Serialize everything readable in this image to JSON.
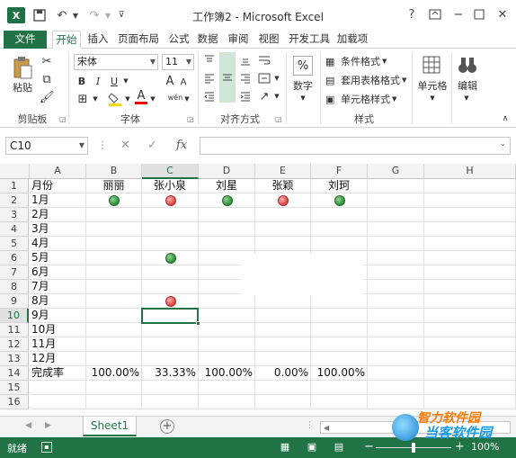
{
  "title_bar": {
    "logo": "X",
    "window_title": "工作簿2 - Microsoft Excel",
    "help": "?",
    "icons": [
      "excel-logo-icon",
      "save-icon",
      "undo-icon",
      "redo-icon",
      "help-icon",
      "ribbon-display-icon",
      "minimize-icon",
      "restore-icon",
      "close-icon"
    ]
  },
  "tabs": {
    "file": "文件",
    "home": "开始",
    "insert": "插入",
    "layout": "页面布局",
    "formula": "公式",
    "data": "数据",
    "review": "审阅",
    "view": "视图",
    "dev": "开发工具",
    "addins": "加载项"
  },
  "ribbon": {
    "clipboard": {
      "paste": "粘贴",
      "label": "剪贴板"
    },
    "font": {
      "name": "宋体",
      "size": "11",
      "bold": "B",
      "italic": "I",
      "underline": "U",
      "font_color_glyph": "A",
      "phonetic": "wén",
      "grow": "A",
      "shrink": "A",
      "label": "字体"
    },
    "alignment": {
      "label": "对齐方式"
    },
    "number": {
      "symbol": "%",
      "label": "数字"
    },
    "styles": {
      "conditional": "条件格式",
      "table": "套用表格格式",
      "cell_styles": "单元格样式",
      "label": "样式"
    },
    "cells": {
      "label": "单元格"
    },
    "editing": {
      "label": "编辑"
    }
  },
  "formula_bar": {
    "name_box": "C10",
    "fx": "fx",
    "value": ""
  },
  "columns": [
    "A",
    "B",
    "C",
    "D",
    "E",
    "F",
    "G",
    "H"
  ],
  "selected_column": "C",
  "selected_row": 10,
  "rows": [
    {
      "n": "1",
      "cells": [
        "月份",
        "丽丽",
        "张小泉",
        "刘星",
        "张颖",
        "刘珂",
        "",
        ""
      ]
    },
    {
      "n": "2",
      "cells": [
        "1月",
        "",
        "",
        "",
        "",
        "",
        "",
        ""
      ]
    },
    {
      "n": "3",
      "cells": [
        "2月",
        "",
        "",
        "",
        "",
        "",
        "",
        ""
      ]
    },
    {
      "n": "4",
      "cells": [
        "3月",
        "",
        "",
        "",
        "",
        "",
        "",
        ""
      ]
    },
    {
      "n": "5",
      "cells": [
        "4月",
        "",
        "",
        "",
        "",
        "",
        "",
        ""
      ]
    },
    {
      "n": "6",
      "cells": [
        "5月",
        "",
        "",
        "",
        "",
        "",
        "",
        ""
      ]
    },
    {
      "n": "7",
      "cells": [
        "6月",
        "",
        "",
        "",
        "",
        "",
        "",
        ""
      ]
    },
    {
      "n": "8",
      "cells": [
        "7月",
        "",
        "",
        "",
        "",
        "",
        "",
        ""
      ]
    },
    {
      "n": "9",
      "cells": [
        "8月",
        "",
        "",
        "",
        "",
        "",
        "",
        ""
      ]
    },
    {
      "n": "10",
      "cells": [
        "9月",
        "",
        "",
        "",
        "",
        "",
        "",
        ""
      ]
    },
    {
      "n": "11",
      "cells": [
        "10月",
        "",
        "",
        "",
        "",
        "",
        "",
        ""
      ]
    },
    {
      "n": "12",
      "cells": [
        "11月",
        "",
        "",
        "",
        "",
        "",
        "",
        ""
      ]
    },
    {
      "n": "13",
      "cells": [
        "12月",
        "",
        "",
        "",
        "",
        "",
        "",
        ""
      ]
    },
    {
      "n": "14",
      "cells": [
        "完成率",
        "100.00%",
        "33.33%",
        "100.00%",
        "0.00%",
        "100.00%",
        "",
        ""
      ]
    },
    {
      "n": "15",
      "cells": [
        "",
        "",
        "",
        "",
        "",
        "",
        "",
        ""
      ]
    },
    {
      "n": "16",
      "cells": [
        "",
        "",
        "",
        "",
        "",
        "",
        "",
        ""
      ]
    }
  ],
  "status_icons": [
    {
      "row": 2,
      "col": 1,
      "status": "green"
    },
    {
      "row": 2,
      "col": 2,
      "status": "red"
    },
    {
      "row": 2,
      "col": 3,
      "status": "green"
    },
    {
      "row": 2,
      "col": 4,
      "status": "red"
    },
    {
      "row": 2,
      "col": 5,
      "status": "green"
    },
    {
      "row": 6,
      "col": 2,
      "status": "green"
    },
    {
      "row": 9,
      "col": 2,
      "status": "red"
    }
  ],
  "colors": {
    "green_icon": "#2e8b3a",
    "red_icon": "#d9413f",
    "accent": "#217346"
  },
  "sheet_tabs": {
    "active": "Sheet1",
    "add": "+"
  },
  "status_bar": {
    "ready": "就绪",
    "zoom_minus": "−",
    "zoom_plus": "+",
    "zoom": "100%",
    "zoom_fraction": 0.5
  },
  "watermark": {
    "line1": "智力软件园",
    "line2": "当客软件园"
  }
}
